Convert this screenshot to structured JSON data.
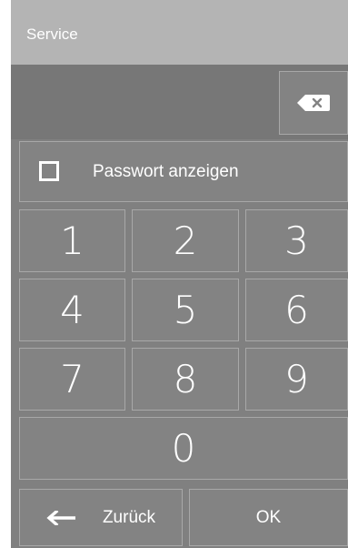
{
  "header": {
    "title": "Service"
  },
  "keypad": {
    "backspace_icon": "backspace-icon",
    "show_password_label": "Passwort anzeigen",
    "digits": [
      "1",
      "2",
      "3",
      "4",
      "5",
      "6",
      "7",
      "8",
      "9",
      "0"
    ],
    "back_label": "Zurück",
    "back_icon": "arrow-left-icon",
    "ok_label": "OK"
  },
  "colors": {
    "titlebar": "#b4b4b4",
    "panel": "#808080",
    "key": "#838383",
    "key_border": "#a8a8a8",
    "text": "#ffffff"
  }
}
